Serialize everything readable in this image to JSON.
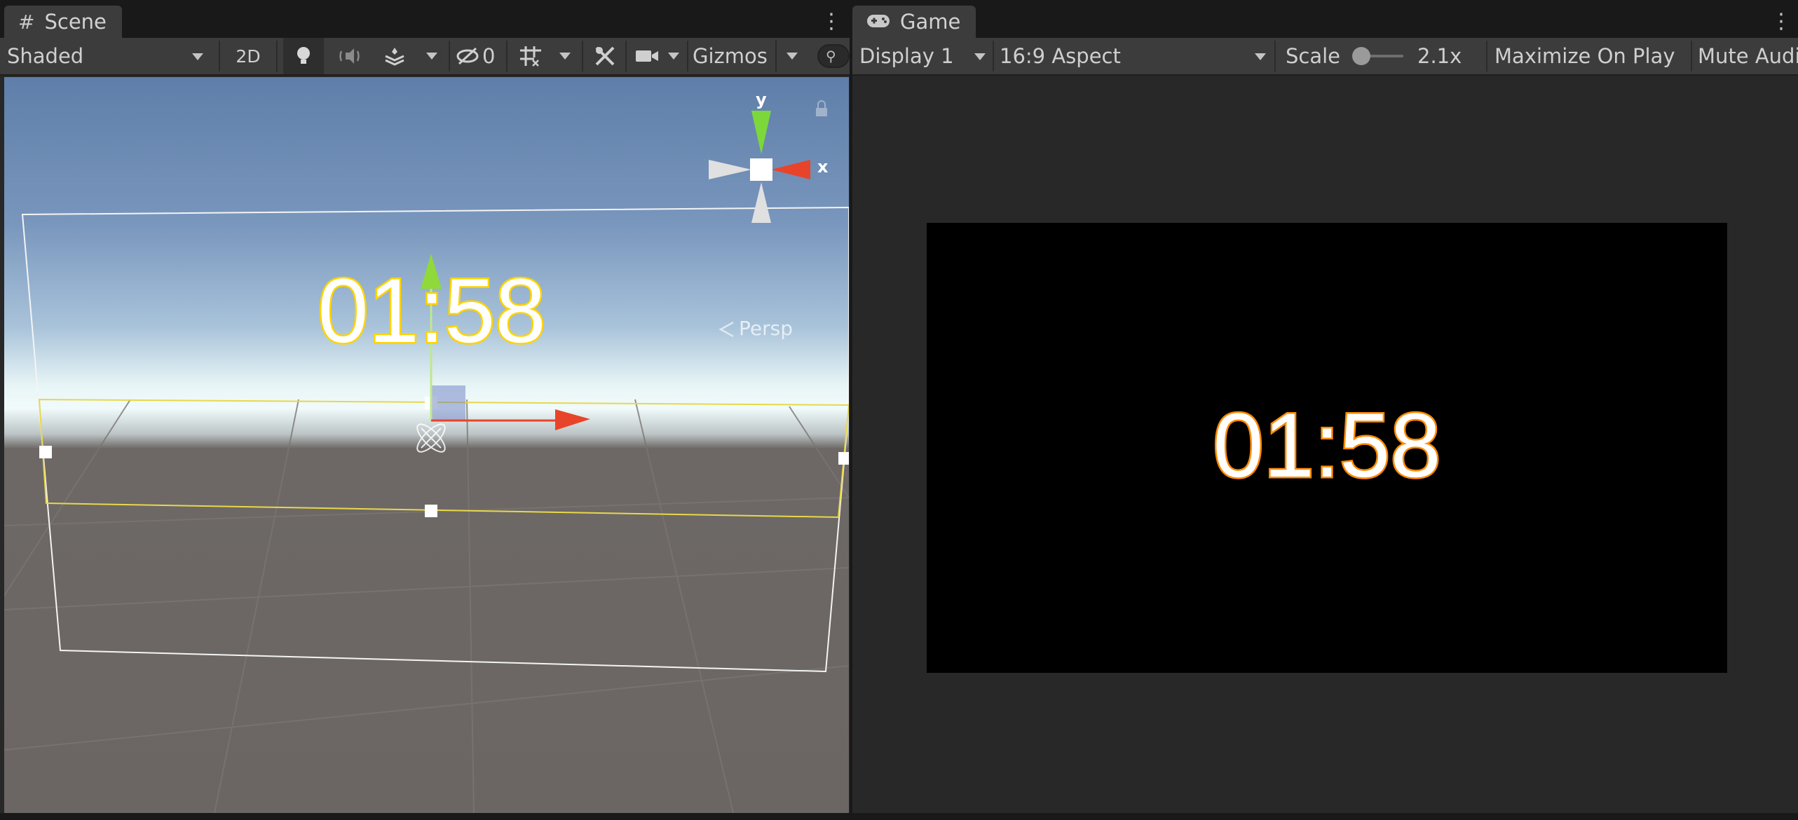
{
  "scene_panel": {
    "tab_label": "Scene",
    "tab_icon": "hash-icon",
    "toolbar": {
      "draw_mode": "Shaded",
      "mode_2d": "2D",
      "hidden_count": "0",
      "gizmos": "Gizmos"
    },
    "view": {
      "persp_label": "Persp",
      "axis_y": "y",
      "axis_x": "x",
      "timer_text": "01:58"
    }
  },
  "game_panel": {
    "tab_label": "Game",
    "tab_icon": "gamepad-icon",
    "toolbar": {
      "display": "Display 1",
      "aspect": "16:9 Aspect",
      "scale_label": "Scale",
      "scale_value": "2.1x",
      "scale_level": 0.05,
      "maximize": "Maximize On Play",
      "mute": "Mute Audio"
    },
    "view": {
      "timer_text": "01:58"
    }
  },
  "colors": {
    "timer_fill": "#ffffff",
    "timer_outline_game": "#ff8a00",
    "timer_outline_scene": "#ffd400",
    "axis_x": "#e8442a",
    "axis_y": "#8fd93a",
    "selection": "#e8d84a"
  }
}
